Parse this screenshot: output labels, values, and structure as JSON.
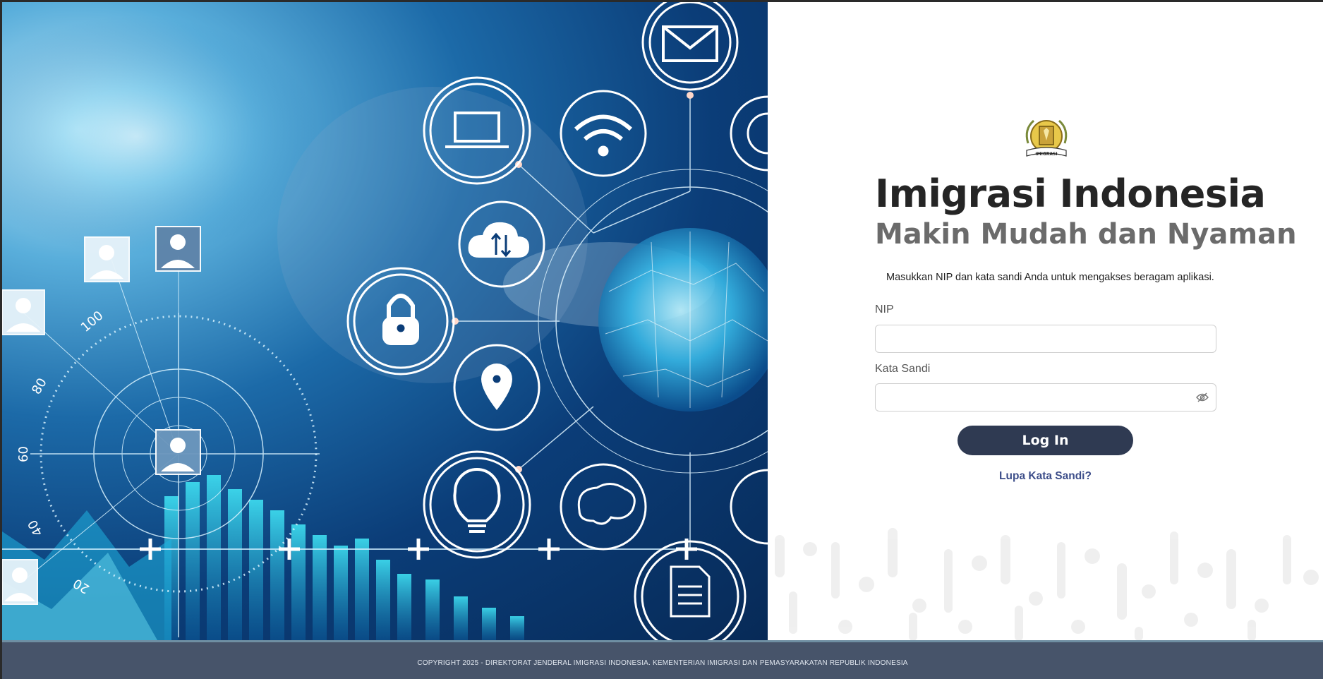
{
  "brand": {
    "title": "Imigrasi Indonesia",
    "subtitle": "Makin Mudah dan Nyaman",
    "logo_text": "IMIGRASI"
  },
  "login": {
    "description": "Masukkan NIP dan kata sandi Anda untuk mengakses beragam aplikasi.",
    "nip_label": "NIP",
    "nip_value": "",
    "password_label": "Kata Sandi",
    "password_value": "",
    "submit_label": "Log In",
    "forgot_label": "Lupa Kata Sandi?"
  },
  "hero": {
    "gauge_labels": [
      "100",
      "80",
      "60",
      "40",
      "20"
    ],
    "icons": [
      "envelope-icon",
      "laptop-icon",
      "wifi-icon",
      "globe-icon",
      "cloud-sync-icon",
      "lock-icon",
      "location-pin-icon",
      "lightbulb-icon",
      "brain-icon",
      "document-icon",
      "user-icon"
    ]
  },
  "footer": {
    "copyright": "COPYRIGHT 2025 - DIREKTORAT JENDERAL IMIGRASI INDONESIA. KEMENTERIAN IMIGRASI DAN PEMASYARAKATAN REPUBLIK INDONESIA"
  },
  "colors": {
    "button": "#2f3a52",
    "link": "#3d4e8a",
    "footer": "#47546a",
    "title": "#252525",
    "subtitle": "#6b6b6b"
  }
}
